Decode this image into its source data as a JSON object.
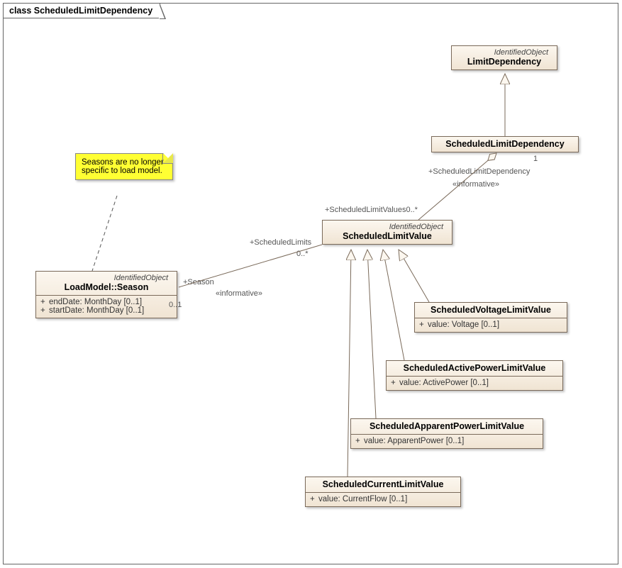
{
  "diagram_title": "class ScheduledLimitDependency",
  "note_text": "Seasons are no longer specific to load model.",
  "classes": {
    "limitDependency": {
      "stereotype": "IdentifiedObject",
      "name": "LimitDependency"
    },
    "scheduledLimitDependency": {
      "name": "ScheduledLimitDependency"
    },
    "scheduledLimitValue": {
      "stereotype": "IdentifiedObject",
      "name": "ScheduledLimitValue"
    },
    "season": {
      "stereotype": "IdentifiedObject",
      "name": "LoadModel::Season",
      "attrs": [
        {
          "vis": "+",
          "text": "endDate: MonthDay [0..1]"
        },
        {
          "vis": "+",
          "text": "startDate: MonthDay [0..1]"
        }
      ]
    },
    "scheduledVoltage": {
      "name": "ScheduledVoltageLimitValue",
      "attrs": [
        {
          "vis": "+",
          "text": "value: Voltage [0..1]"
        }
      ]
    },
    "scheduledActive": {
      "name": "ScheduledActivePowerLimitValue",
      "attrs": [
        {
          "vis": "+",
          "text": "value: ActivePower [0..1]"
        }
      ]
    },
    "scheduledApparent": {
      "name": "ScheduledApparentPowerLimitValue",
      "attrs": [
        {
          "vis": "+",
          "text": "value: ApparentPower [0..1]"
        }
      ]
    },
    "scheduledCurrent": {
      "name": "ScheduledCurrentLimitValue",
      "attrs": [
        {
          "vis": "+",
          "text": "value: CurrentFlow [0..1]"
        }
      ]
    }
  },
  "labels": {
    "assoc1_role1": "+ScheduledLimitDependency",
    "assoc1_mult1": "1",
    "assoc1_stereo": "«informative»",
    "assoc1_role2": "+ScheduledLimitValues",
    "assoc1_mult2": "0..*",
    "assoc2_role1": "+ScheduledLimits",
    "assoc2_mult1": "0..*",
    "assoc2_role2": "+Season",
    "assoc2_mult2": "0..1",
    "assoc2_stereo": "«informative»"
  }
}
